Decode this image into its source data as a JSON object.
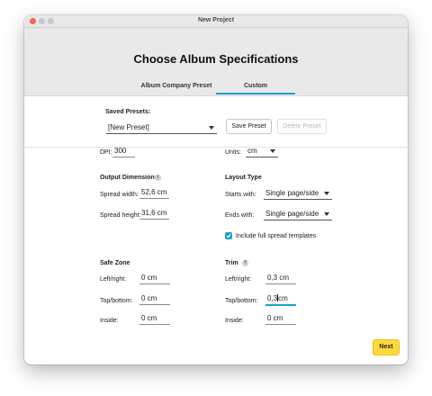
{
  "window": {
    "title": "New Project"
  },
  "page": {
    "title": "Choose Album Specifications"
  },
  "tabs": [
    {
      "label": "Album Company Preset",
      "active": false
    },
    {
      "label": "Custom",
      "active": true
    }
  ],
  "presets": {
    "label": "Saved Presets:",
    "selected": "[New Preset]",
    "save_label": "Save Preset",
    "delete_label": "Delete Preset"
  },
  "dpi": {
    "label": "DPI:",
    "value": "300"
  },
  "units": {
    "label": "Units:",
    "value": "cm"
  },
  "output_dimensions": {
    "heading": "Output Dimensions",
    "spread_width_label": "Spread width:",
    "spread_width_value": "52,6 cm",
    "spread_height_label": "Spread height:",
    "spread_height_value": "31,6 cm"
  },
  "layout_type": {
    "heading": "Layout Type",
    "starts_label": "Starts with:",
    "starts_value": "Single page/side",
    "ends_label": "Ends with:",
    "ends_value": "Single page/side",
    "include_label": "Include full spread templates",
    "include_checked": true
  },
  "safe_zone": {
    "heading": "Safe Zone",
    "left_right_label": "Left/right:",
    "left_right_value": "0 cm",
    "top_bottom_label": "Top/bottom:",
    "top_bottom_value": "0 cm",
    "inside_label": "Inside:",
    "inside_value": "0 cm"
  },
  "trim": {
    "heading": "Trim",
    "left_right_label": "Left/right:",
    "left_right_value": "0,3 cm",
    "top_bottom_label": "Top/bottom:",
    "top_bottom_before_cursor": "0,3",
    "top_bottom_after_cursor": "cm",
    "inside_label": "Inside:",
    "inside_value": "0 cm"
  },
  "footer": {
    "next_label": "Next"
  },
  "colors": {
    "accent": "#1ea0c8",
    "next_button": "#ffd93b"
  }
}
